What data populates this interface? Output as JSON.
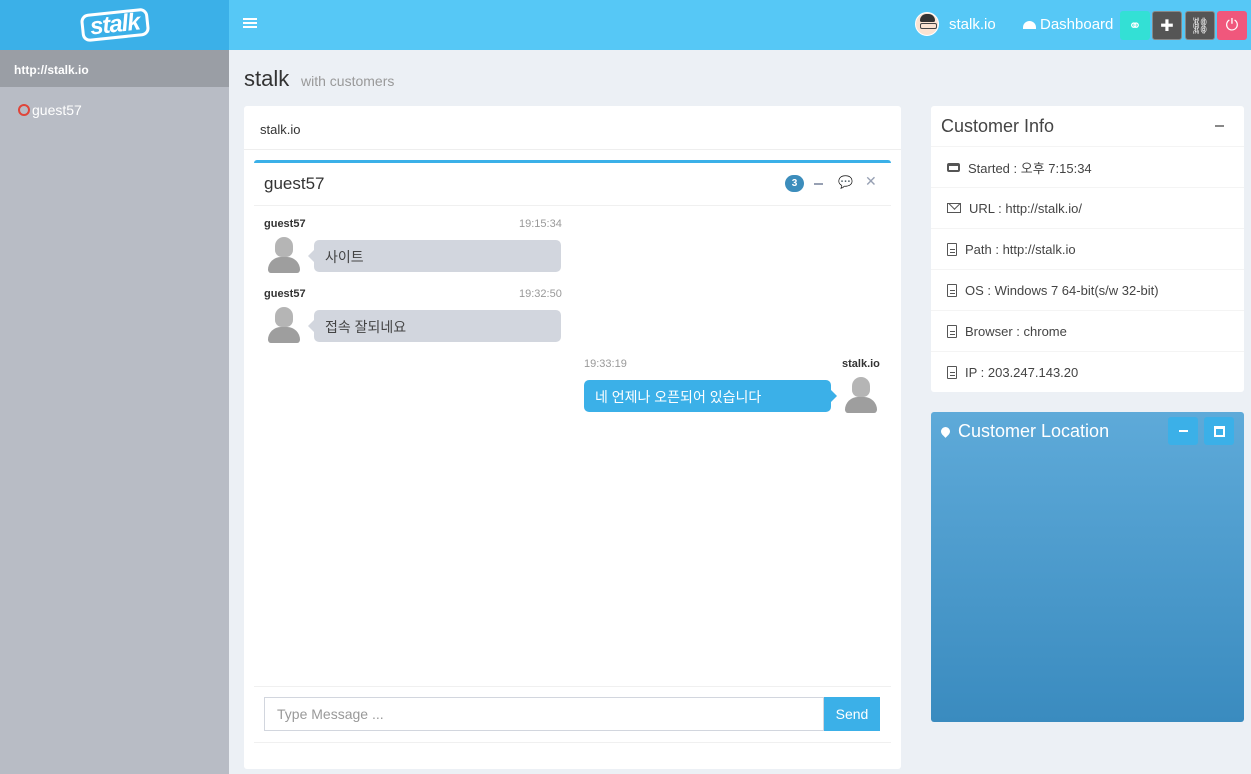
{
  "brand": {
    "logo_text": "stalk"
  },
  "topbar": {
    "user_name": "stalk.io",
    "dashboard_label": "Dashboard"
  },
  "sidebar": {
    "site": "http://stalk.io",
    "guests": [
      {
        "name": "guest57",
        "status_color": "#e0453a"
      }
    ]
  },
  "page": {
    "title": "stalk",
    "subtitle": "with customers"
  },
  "chat_panel": {
    "header": "stalk.io",
    "chat": {
      "title": "guest57",
      "unread_count": "3",
      "messages": [
        {
          "name": "guest57",
          "time": "19:15:34",
          "text": "사이트",
          "side": "left"
        },
        {
          "name": "guest57",
          "time": "19:32:50",
          "text": "접속 잘되네요",
          "side": "left"
        },
        {
          "name": "stalk.io",
          "time": "19:33:19",
          "text": "네 언제나 오픈되어 있습니다",
          "side": "right"
        }
      ],
      "input_placeholder": "Type Message ...",
      "send_label": "Send"
    }
  },
  "customer_info": {
    "title": "Customer Info",
    "rows": [
      {
        "icon": "inbox-icon",
        "text": "Started : 오후 7:15:34"
      },
      {
        "icon": "envelope-icon",
        "text": "URL : http://stalk.io/"
      },
      {
        "icon": "file-icon",
        "text": "Path : http://stalk.io"
      },
      {
        "icon": "file-icon",
        "text": "OS : Windows 7 64-bit(s/w 32-bit)"
      },
      {
        "icon": "file-icon",
        "text": "Browser : chrome"
      },
      {
        "icon": "file-icon",
        "text": "IP : 203.247.143.20"
      }
    ]
  },
  "customer_location": {
    "title": "Customer Location"
  },
  "colors": {
    "accent": "#3bb0e8",
    "topbar": "#56c8f6",
    "badge": "#3c8dbc",
    "status_offline": "#e0453a"
  }
}
